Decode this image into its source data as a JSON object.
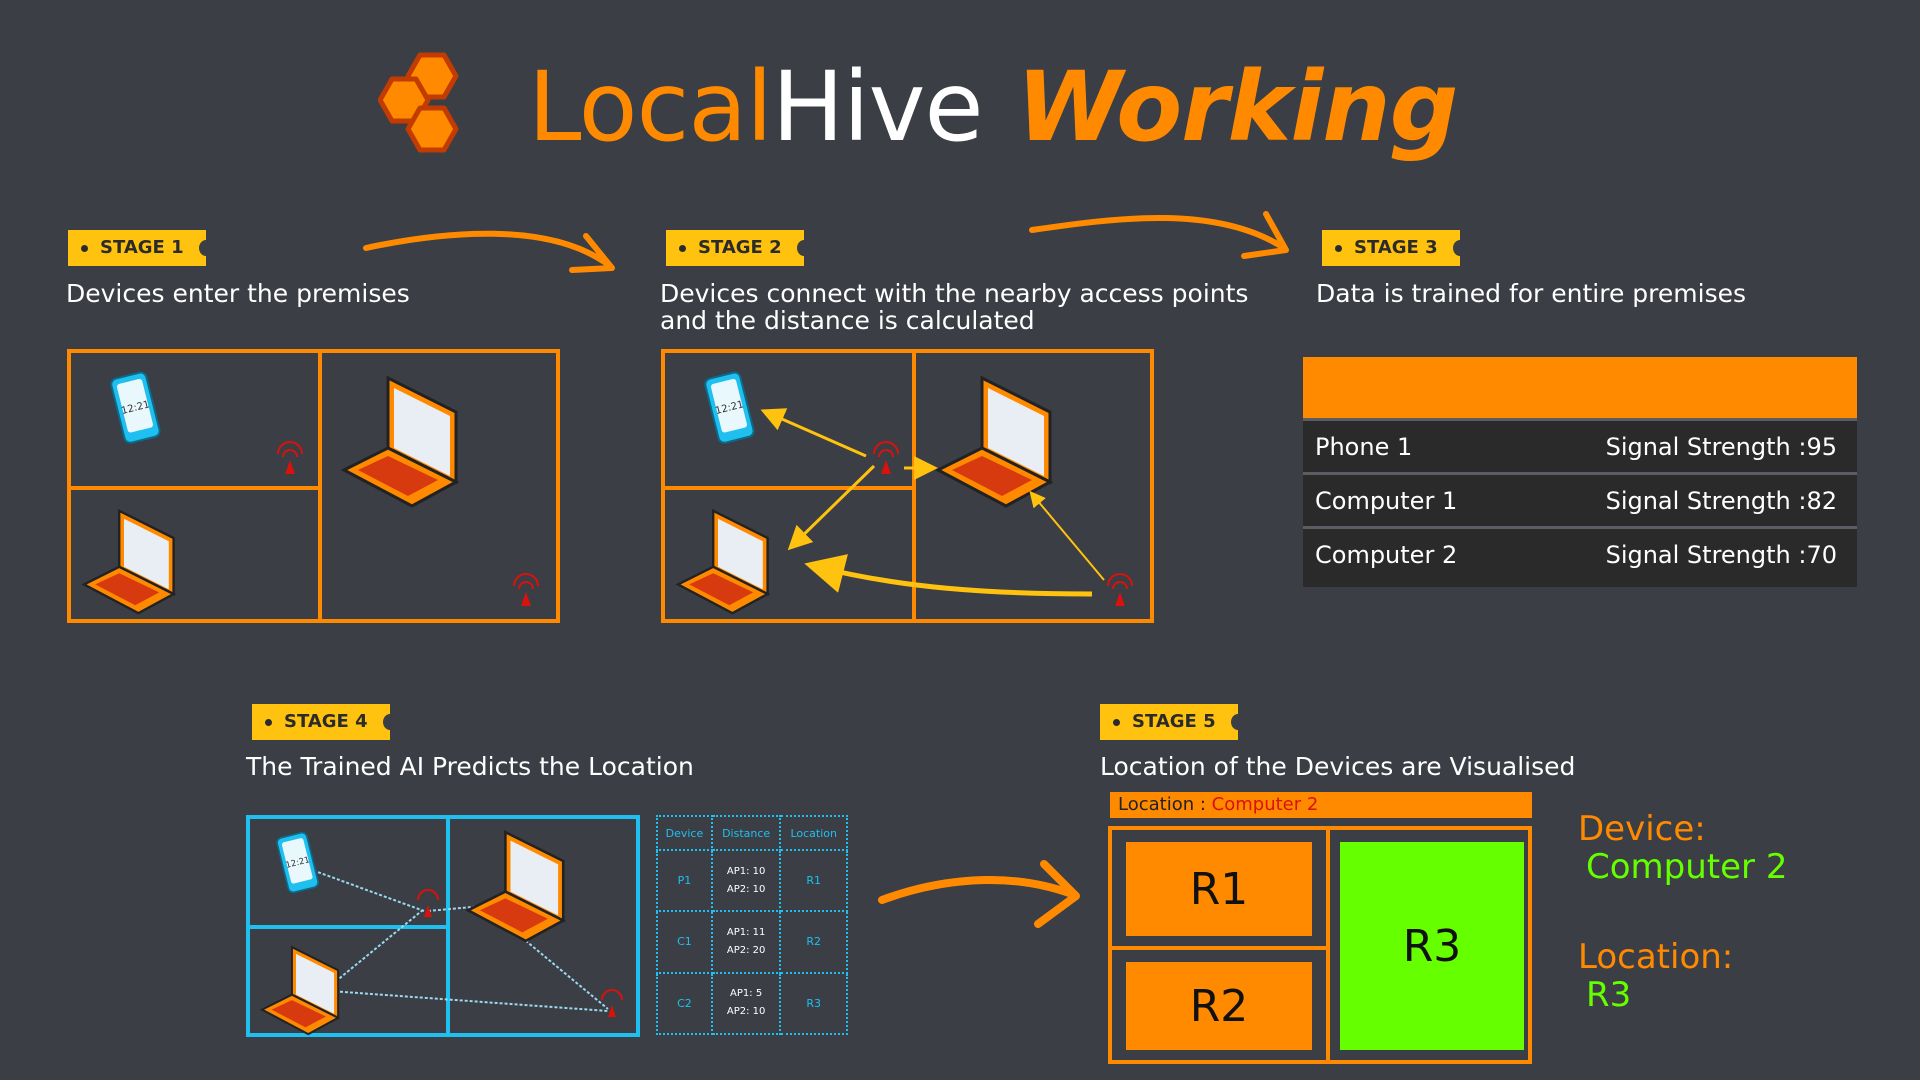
{
  "title": {
    "part1": "Local",
    "part2": "Hive",
    "part3": "Working"
  },
  "colors": {
    "accent": "#ff8a00",
    "badge": "#ffc20e",
    "cyan": "#1fc0ef",
    "green": "#66ff00",
    "background": "#3b3e45"
  },
  "stages": [
    {
      "badge": "STAGE 1",
      "description": "Devices enter the premises"
    },
    {
      "badge": "STAGE 2",
      "description": "Devices connect with the nearby access points",
      "description2": "and the distance is calculated"
    },
    {
      "badge": "STAGE 3",
      "description": "Data is trained for entire premises"
    },
    {
      "badge": "STAGE 4",
      "description": "The Trained AI Predicts the Location"
    },
    {
      "badge": "STAGE 5",
      "description": "Location of the Devices are Visualised"
    }
  ],
  "signal_table": {
    "rows": [
      {
        "device": "Phone 1",
        "signal": "Signal Strength :95"
      },
      {
        "device": "Computer 1",
        "signal": "Signal Strength :82"
      },
      {
        "device": "Computer 2",
        "signal": "Signal Strength :70"
      }
    ]
  },
  "prediction_table": {
    "headers": [
      "Device",
      "Distance",
      "Location"
    ],
    "rows": [
      {
        "device": "P1",
        "d1": "AP1: 10",
        "d2": "AP2: 10",
        "location": "R1"
      },
      {
        "device": "C1",
        "d1": "AP1: 11",
        "d2": "AP2: 20",
        "location": "R2"
      },
      {
        "device": "C2",
        "d1": "AP1: 5",
        "d2": "AP2: 10",
        "location": "R3"
      }
    ]
  },
  "visualisation": {
    "location_label": "Location :",
    "location_value": "Computer 2",
    "rooms": [
      "R1",
      "R2",
      "R3"
    ],
    "device_label": "Device:",
    "device_value": "Computer 2",
    "result_label": "Location:",
    "result_value": "R3"
  },
  "icons": [
    "hive-logo",
    "phone-icon",
    "laptop-icon",
    "access-point-icon",
    "arrow-icon"
  ]
}
